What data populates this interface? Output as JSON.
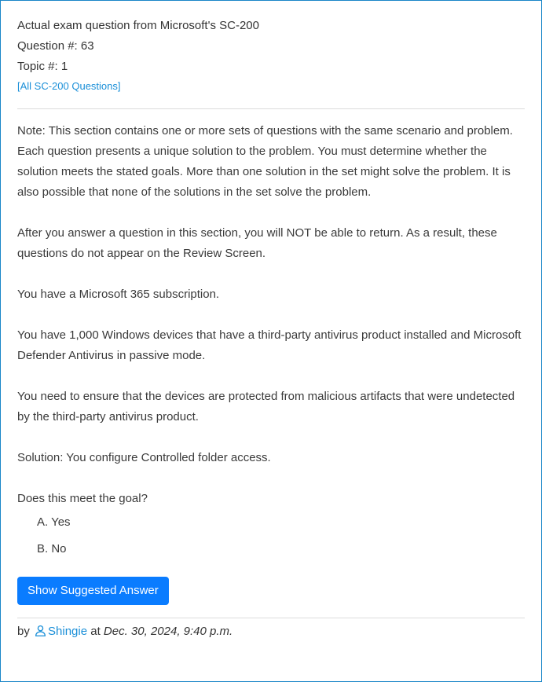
{
  "header": {
    "title": "Actual exam question from Microsoft's SC-200",
    "question_number": "Question #: 63",
    "topic": "Topic #: 1",
    "all_link": "[All SC-200 Questions]"
  },
  "question": {
    "paragraphs": [
      "Note: This section contains one or more sets of questions with the same scenario and problem. Each question presents a unique solution to the problem. You must determine whether the solution meets the stated goals. More than one solution in the set might solve the problem. It is also possible that none of the solutions in the set solve the problem.",
      "After you answer a question in this section, you will NOT be able to return. As a result, these questions do not appear on the Review Screen.",
      "You have a Microsoft 365 subscription.",
      "You have 1,000 Windows devices that have a third-party antivirus product installed and Microsoft Defender Antivirus in passive mode.",
      "You need to ensure that the devices are protected from malicious artifacts that were undetected by the third-party antivirus product.",
      "Solution: You configure Controlled folder access.",
      "Does this meet the goal?"
    ],
    "choices": [
      "A. Yes",
      "B. No"
    ]
  },
  "actions": {
    "show_answer_label": "Show Suggested Answer"
  },
  "footer": {
    "by": "by",
    "user_icon": "user-icon",
    "username": "Shingie",
    "at": "at",
    "date": "Dec. 30, 2024, 9:40 p.m."
  },
  "colors": {
    "border": "#1a86c8",
    "link": "#1a8fd8",
    "button": "#0a7cff"
  }
}
